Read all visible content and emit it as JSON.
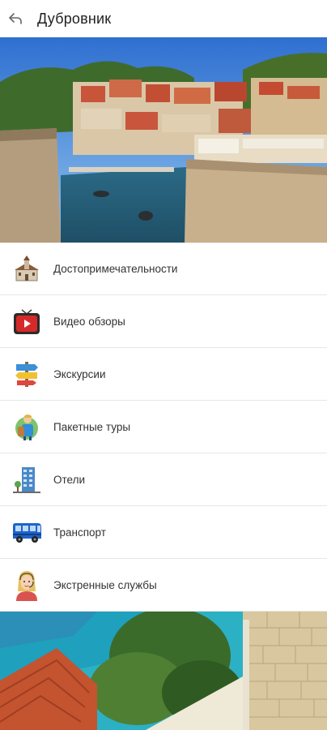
{
  "header": {
    "title": "Дубровник",
    "back_icon": "back-arrow-icon"
  },
  "hero": {
    "image": "dubrovnik-harbor-photo"
  },
  "menu": {
    "items": [
      {
        "label": "Достопримечательности",
        "icon": "church-icon"
      },
      {
        "label": "Видео обзоры",
        "icon": "video-tv-icon"
      },
      {
        "label": "Экскурсии",
        "icon": "signpost-icon"
      },
      {
        "label": "Пакетные туры",
        "icon": "traveler-icon"
      },
      {
        "label": "Отели",
        "icon": "hotel-building-icon"
      },
      {
        "label": "Транспорт",
        "icon": "bus-icon"
      },
      {
        "label": "Экстренные службы",
        "icon": "operator-woman-icon"
      }
    ]
  },
  "footer_image": "sea-roof-photo",
  "colors": {
    "background": "#ffffff",
    "divider": "#e6e6e6",
    "text": "#333333"
  }
}
